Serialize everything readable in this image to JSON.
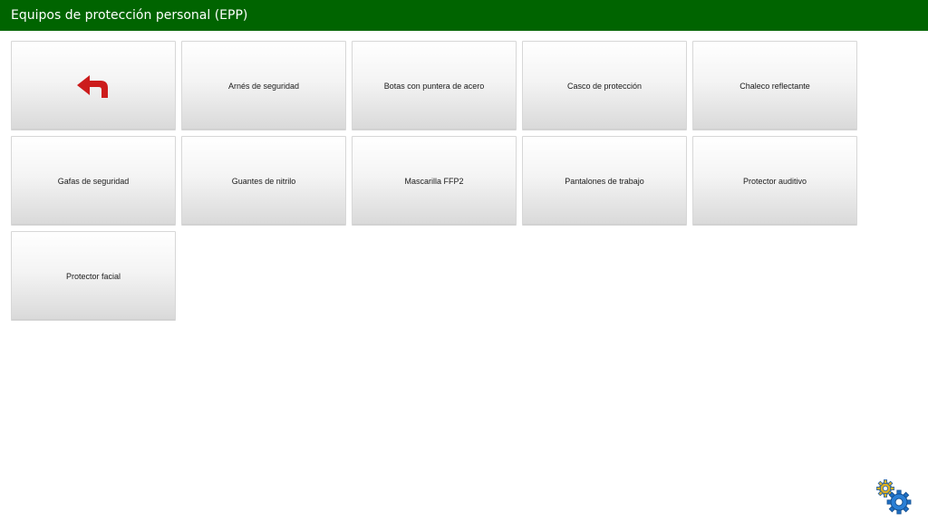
{
  "header": {
    "title": "Equipos de protección personal (EPP)"
  },
  "colors": {
    "header_bg": "#006400",
    "back_arrow": "#cc1c1c",
    "gear_small": "#e0b020",
    "gear_large": "#1f6fc4"
  },
  "icons": {
    "back": "back-arrow-icon",
    "settings": "settings-gears-icon"
  },
  "tiles": [
    {
      "label": "Arnés de seguridad"
    },
    {
      "label": "Botas con puntera de acero"
    },
    {
      "label": "Casco de protección"
    },
    {
      "label": "Chaleco reflectante"
    },
    {
      "label": "Gafas de seguridad"
    },
    {
      "label": "Guantes de nitrilo"
    },
    {
      "label": "Mascarilla FFP2"
    },
    {
      "label": "Pantalones de trabajo"
    },
    {
      "label": "Protector auditivo"
    },
    {
      "label": "Protector facial"
    }
  ]
}
